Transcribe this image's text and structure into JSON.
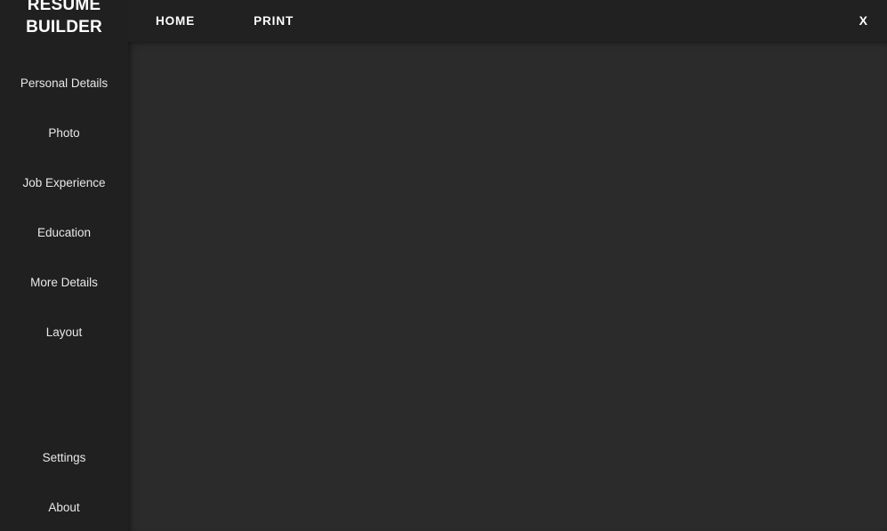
{
  "app": {
    "title_line1": "RESUME",
    "title_line2": "BUILDER",
    "colors": {
      "sidebar_bg": "#202020",
      "header_bg": "#212121",
      "content_bg": "#2b2b2b",
      "text": "#e8e8e8",
      "text_bright": "#ffffff"
    }
  },
  "header": {
    "nav": [
      {
        "label": "HOME"
      },
      {
        "label": "PRINT"
      }
    ],
    "close_label": "X"
  },
  "sidebar": {
    "items": [
      {
        "label": "Personal Details"
      },
      {
        "label": "Photo"
      },
      {
        "label": "Job Experience"
      },
      {
        "label": "Education"
      },
      {
        "label": "More Details"
      },
      {
        "label": "Layout"
      }
    ],
    "bottom_items": [
      {
        "label": "Settings"
      },
      {
        "label": "About"
      }
    ]
  },
  "main": {
    "content_text": ""
  }
}
